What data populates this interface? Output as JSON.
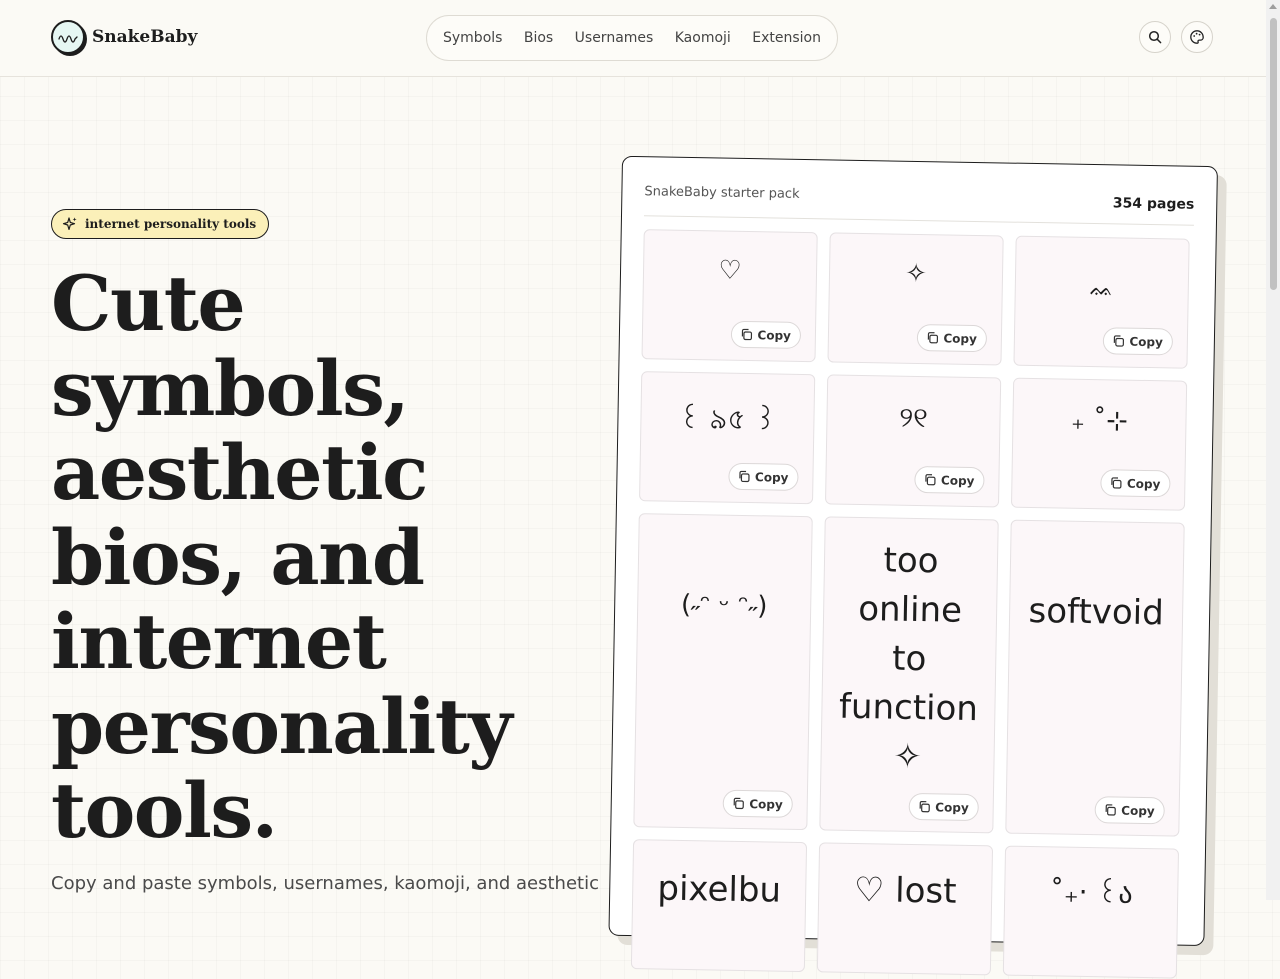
{
  "brand": {
    "name": "SnakeBaby"
  },
  "nav": {
    "items": [
      "Symbols",
      "Bios",
      "Usernames",
      "Kaomoji",
      "Extension"
    ]
  },
  "header": {
    "search_icon": "search-icon",
    "theme_icon": "palette-icon"
  },
  "hero": {
    "badge": "internet personality tools",
    "headline": [
      "Cute",
      "symbols,",
      "aesthetic",
      "bios, and",
      "internet",
      "personality",
      "tools."
    ],
    "subtext": "Copy and paste symbols, usernames, kaomoji, and aesthetic"
  },
  "card": {
    "title": "SnakeBaby starter pack",
    "count": "354 pages",
    "copy_label": "Copy",
    "tiles": [
      {
        "text": "♡"
      },
      {
        "text": "✧"
      },
      {
        "text": "ᨐ"
      },
      {
        "text": "꒰ ৯৫ ꒱"
      },
      {
        "text": "୨୧"
      },
      {
        "text": "₊ ˚⊹"
      },
      {
        "text": "(˶ᵔ ᵕ ᵔ˶)"
      },
      {
        "text": "too online to function ✧"
      },
      {
        "text": "softvoid"
      },
      {
        "text": "pixelbu"
      },
      {
        "text": "♡ lost"
      },
      {
        "text": "˚₊‧ ꒰ა"
      }
    ]
  },
  "colors": {
    "background": "#fbfaf5",
    "badge": "#fbf0b9",
    "tile": "#fcf7f9",
    "ink": "#1d1d1d"
  }
}
